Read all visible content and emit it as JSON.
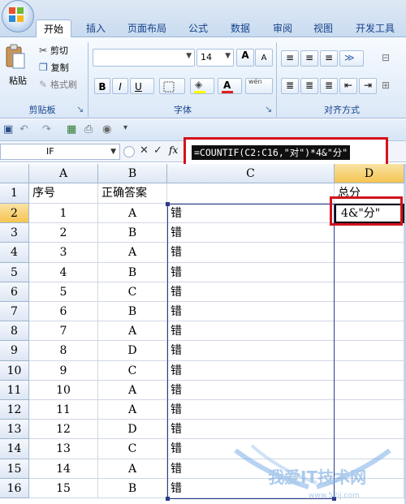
{
  "ribbon_tabs": [
    "开始",
    "插入",
    "页面布局",
    "公式",
    "数据",
    "审阅",
    "视图",
    "开发工具"
  ],
  "clipboard": {
    "paste": "粘贴",
    "cut": "剪切",
    "copy": "复制",
    "format_painter": "格式刷",
    "group_label": "剪贴板"
  },
  "font": {
    "size": "14",
    "grow": "A",
    "shrink": "A",
    "bold": "B",
    "italic": "I",
    "underline": "U",
    "font_color": "A",
    "phonetic": "wén",
    "group_label": "字体"
  },
  "alignment": {
    "group_label": "对齐方式"
  },
  "formula_bar": {
    "name_box": "IF",
    "fx": "fx",
    "cancel": "✕",
    "enter": "✓",
    "formula": "=COUNTIF(C2:C16,\"对\")*4&\"分\""
  },
  "columns": [
    "A",
    "B",
    "C",
    "D"
  ],
  "header_row": {
    "a": "序号",
    "b": "正确答案",
    "c": "",
    "d": "总分"
  },
  "active_cell_text": "4&\"分\"",
  "rows": [
    {
      "row": "2",
      "a": "1",
      "b": "A",
      "c": "错"
    },
    {
      "row": "3",
      "a": "2",
      "b": "B",
      "c": "错"
    },
    {
      "row": "4",
      "a": "3",
      "b": "A",
      "c": "错"
    },
    {
      "row": "5",
      "a": "4",
      "b": "B",
      "c": "错"
    },
    {
      "row": "6",
      "a": "5",
      "b": "C",
      "c": "错"
    },
    {
      "row": "7",
      "a": "6",
      "b": "B",
      "c": "错"
    },
    {
      "row": "8",
      "a": "7",
      "b": "A",
      "c": "错"
    },
    {
      "row": "9",
      "a": "8",
      "b": "D",
      "c": "错"
    },
    {
      "row": "10",
      "a": "9",
      "b": "C",
      "c": "错"
    },
    {
      "row": "11",
      "a": "10",
      "b": "A",
      "c": "错"
    },
    {
      "row": "12",
      "a": "11",
      "b": "A",
      "c": "错"
    },
    {
      "row": "13",
      "a": "12",
      "b": "D",
      "c": "错"
    },
    {
      "row": "14",
      "a": "13",
      "b": "C",
      "c": "错"
    },
    {
      "row": "15",
      "a": "14",
      "b": "A",
      "c": "错"
    },
    {
      "row": "16",
      "a": "15",
      "b": "B",
      "c": "错"
    }
  ],
  "watermark": {
    "text": "我爱IT技术网",
    "url": "www.52ij.com"
  },
  "colors": {
    "annotation_red": "#d3131b",
    "selection_border": "#2d3a8c",
    "ribbon_text": "#15428b"
  }
}
